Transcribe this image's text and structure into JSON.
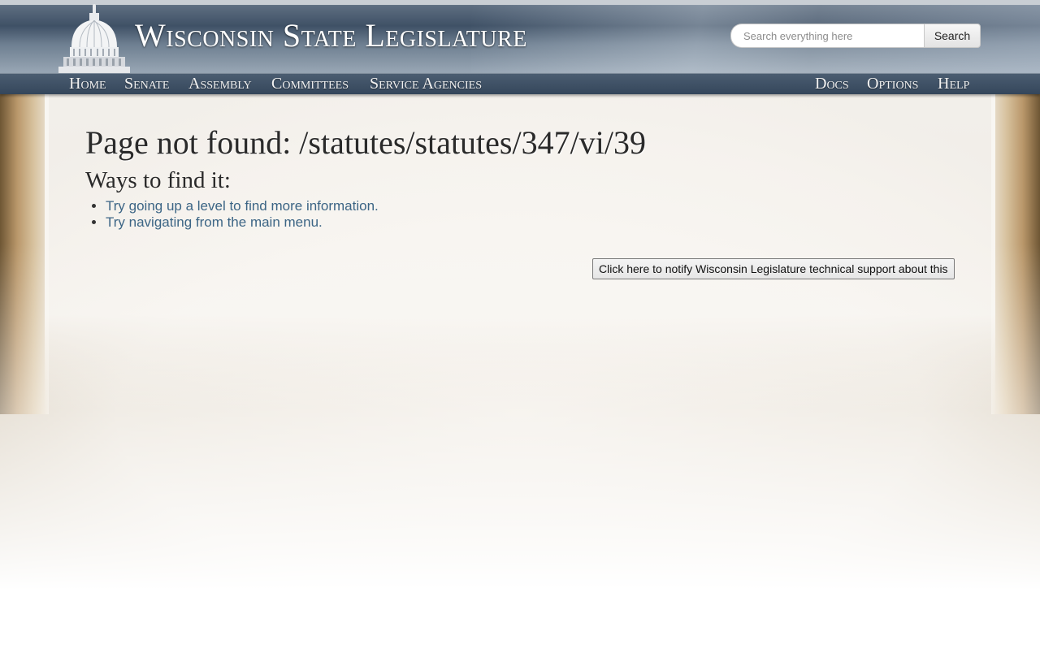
{
  "header": {
    "site_title": "Wisconsin State Legislature",
    "search": {
      "placeholder": "Search everything here",
      "value": "",
      "button_label": "Search"
    }
  },
  "nav": {
    "left_items": [
      {
        "label": "Home"
      },
      {
        "label": "Senate"
      },
      {
        "label": "Assembly"
      },
      {
        "label": "Committees"
      },
      {
        "label": "Service Agencies"
      }
    ],
    "right_items": [
      {
        "label": "Docs"
      },
      {
        "label": "Options"
      },
      {
        "label": "Help"
      }
    ]
  },
  "main": {
    "title": "Page not found: /statutes/statutes/347/vi/39",
    "subtitle": "Ways to find it:",
    "suggestions": [
      {
        "label": "Try going up a level to find more information."
      },
      {
        "label": "Try navigating from the main menu."
      }
    ],
    "notify_button_label": "Click here to notify Wisconsin Legislature technical support about this"
  },
  "colors": {
    "link": "#3c6585",
    "nav_bar": "#34465b",
    "header": "#3f5166"
  }
}
